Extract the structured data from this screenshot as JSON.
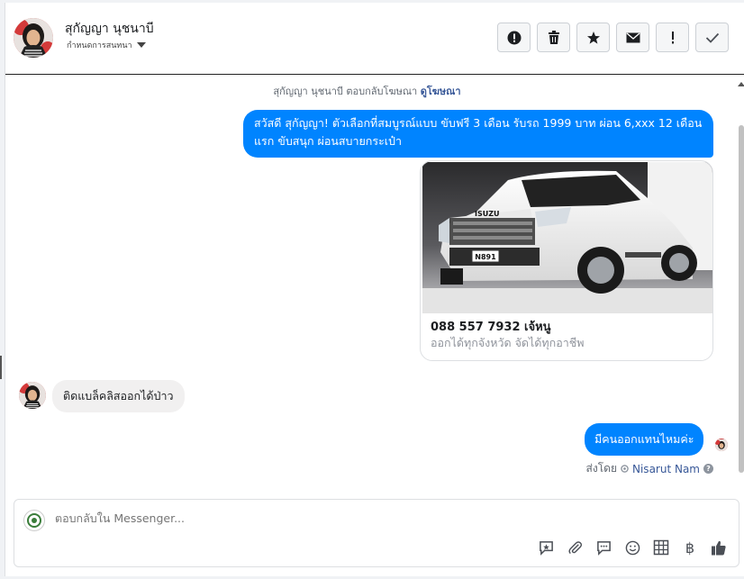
{
  "header": {
    "contact_name": "สุกัญญา นุชนาบี",
    "assign_label": "กำหนดการสนทนา",
    "actions": [
      {
        "icon": "alert-circle-icon",
        "glyph": "!"
      },
      {
        "icon": "trash-icon",
        "glyph": ""
      },
      {
        "icon": "star-icon",
        "glyph": "★"
      },
      {
        "icon": "mail-icon",
        "glyph": "✉"
      },
      {
        "icon": "exclamation-icon",
        "glyph": "!"
      },
      {
        "icon": "check-icon",
        "glyph": "✓"
      }
    ]
  },
  "thread": {
    "notice_text": "สุกัญญา นุชนาบี ตอบกลับโฆษณา ",
    "notice_link": "ดูโฆษณา",
    "outgoing_message_1": "สวัสดี สุกัญญา! ตัวเลือกที่สมบูรณ์แบบ ขับฟรี 3 เดือน รับรถ 1999 บาท ผ่อน 6,xxx 12 เดือนแรก ขับสนุก ผ่อนสบายกระเป๋า",
    "card": {
      "title": "088 557 7932 เจ้หนู",
      "subtitle": "ออกได้ทุกจังหวัด จัดได้ทุกอาชีพ",
      "plate": "N891",
      "brand": "ISUZU"
    },
    "incoming_message": "ติดแบล็คลิสออกได้ป่าว",
    "outgoing_message_2": "มีคนออกแทนไหมค่ะ",
    "sent_by_label": "ส่งโดย",
    "sent_by_author": "Nisarut Nam"
  },
  "composer": {
    "placeholder": "ตอบกลับใน Messenger...",
    "tools": [
      "saved-reply-icon",
      "attachment-icon",
      "chat-bubble-icon",
      "emoji-icon",
      "table-icon",
      "baht-icon",
      "thumbs-up-icon"
    ],
    "baht_glyph": "฿"
  },
  "colors": {
    "messenger_blue": "#0084ff",
    "link_blue": "#385898"
  }
}
